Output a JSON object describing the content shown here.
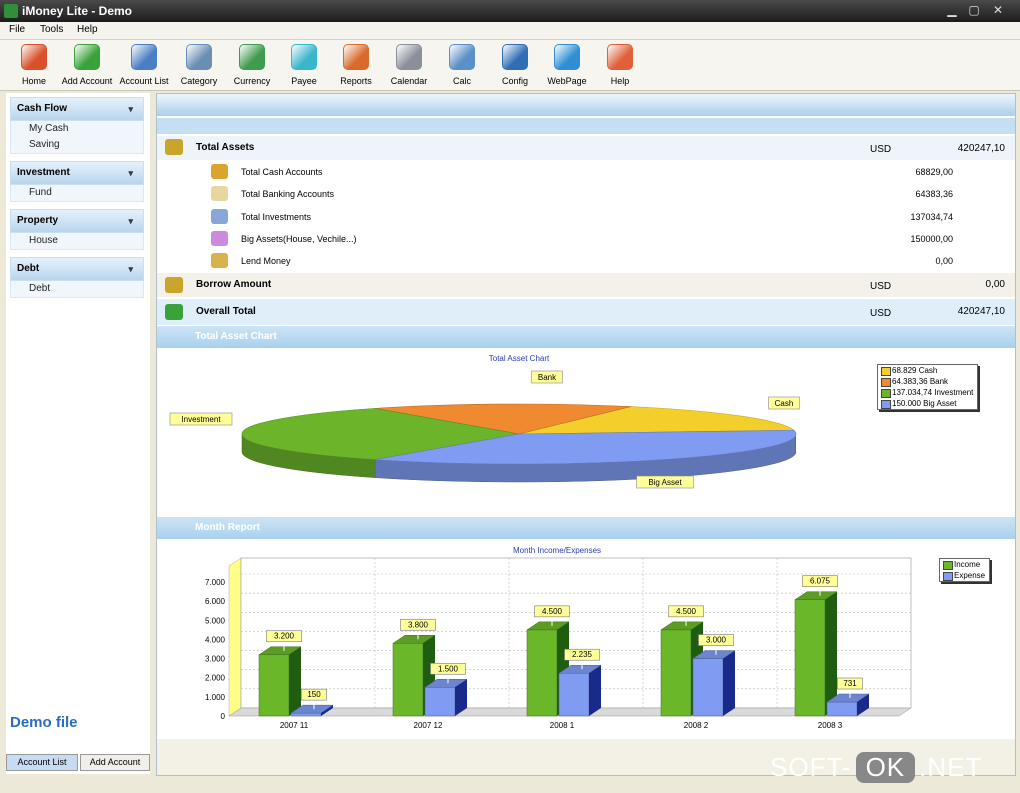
{
  "window": {
    "title": "iMoney Lite - Demo"
  },
  "menu": [
    "File",
    "Tools",
    "Help"
  ],
  "toolbar": [
    {
      "label": "Home",
      "icon": "home-icon",
      "color": "#d9502a"
    },
    {
      "label": "Add Account",
      "icon": "add-account-icon",
      "color": "#3aa23a"
    },
    {
      "label": "Account List",
      "icon": "account-list-icon",
      "color": "#4b7fc4"
    },
    {
      "label": "Category",
      "icon": "category-icon",
      "color": "#6a8fb5"
    },
    {
      "label": "Currency",
      "icon": "currency-icon",
      "color": "#3f9b4f"
    },
    {
      "label": "Payee",
      "icon": "payee-icon",
      "color": "#39b6c9"
    },
    {
      "label": "Reports",
      "icon": "reports-icon",
      "color": "#d86a2a"
    },
    {
      "label": "Calendar",
      "icon": "calendar-icon",
      "color": "#8a8f99"
    },
    {
      "label": "Calc",
      "icon": "calc-icon",
      "color": "#5a8fc7"
    },
    {
      "label": "Config",
      "icon": "config-icon",
      "color": "#2f6db5"
    },
    {
      "label": "WebPage",
      "icon": "globe-icon",
      "color": "#2e8fd4"
    },
    {
      "label": "Help",
      "icon": "help-icon",
      "color": "#e0603a"
    }
  ],
  "sidebar": {
    "groups": [
      {
        "title": "Cash Flow",
        "items": [
          "My Cash",
          "Saving"
        ]
      },
      {
        "title": "Investment",
        "items": [
          "Fund"
        ]
      },
      {
        "title": "Property",
        "items": [
          "House"
        ]
      },
      {
        "title": "Debt",
        "items": [
          "Debt"
        ]
      }
    ],
    "demo_label": "Demo file",
    "tabs": [
      "Account List",
      "Add Account"
    ]
  },
  "summary": {
    "total_assets": {
      "label": "Total Assets",
      "currency": "USD",
      "value": "420247,10"
    },
    "details": [
      {
        "label": "Total Cash Accounts",
        "value": "68829,00"
      },
      {
        "label": "Total Banking Accounts",
        "value": "64383,36"
      },
      {
        "label": "Total Investments",
        "value": "137034,74"
      },
      {
        "label": "Big Assets(House, Vechile...)",
        "value": "150000,00"
      },
      {
        "label": "Lend Money",
        "value": "0,00"
      }
    ],
    "borrow": {
      "label": "Borrow Amount",
      "currency": "USD",
      "value": "0,00"
    },
    "overall": {
      "label": "Overall Total",
      "currency": "USD",
      "value": "420247,10"
    }
  },
  "sections": {
    "asset_chart": "Total Asset Chart",
    "month_report": "Month Report"
  },
  "chart_data": [
    {
      "type": "pie",
      "title": "Total Asset Chart",
      "slices": [
        {
          "name": "Cash",
          "value": 68829,
          "color": "#f2cf2a"
        },
        {
          "name": "Bank",
          "value": 64383.36,
          "color": "#f08a30"
        },
        {
          "name": "Investment",
          "value": 137034.74,
          "color": "#6cb42a"
        },
        {
          "name": "Big Asset",
          "value": 150000,
          "color": "#7f9cf2"
        }
      ],
      "legend": [
        "68.829 Cash",
        "64.383,36 Bank",
        "137.034,74 Investment",
        "150.000 Big Asset"
      ],
      "legend_position": "top-right"
    },
    {
      "type": "bar",
      "title": "Month Income/Expenses",
      "categories": [
        "2007 11",
        "2007 12",
        "2008 1",
        "2008 2",
        "2008 3"
      ],
      "series": [
        {
          "name": "Income",
          "values": [
            3200,
            3800,
            4500,
            4500,
            6075
          ],
          "labels": [
            "3.200",
            "3.800",
            "4.500",
            "4.500",
            "6.075"
          ],
          "color": "#6ab82a"
        },
        {
          "name": "Expense",
          "values": [
            150,
            1500,
            2235,
            3000,
            731
          ],
          "labels": [
            "150",
            "1.500",
            "2.235",
            "3.000",
            "731"
          ],
          "color": "#7f9cf2"
        }
      ],
      "yticks": [
        "0",
        "1.000",
        "2.000",
        "3.000",
        "4.000",
        "5.000",
        "6.000",
        "7.000"
      ],
      "ylim": [
        0,
        7000
      ],
      "grid": true,
      "legend_position": "top-right"
    }
  ],
  "watermark": {
    "left": "SOFT-",
    "mid": "OK",
    "right": ".NET"
  }
}
